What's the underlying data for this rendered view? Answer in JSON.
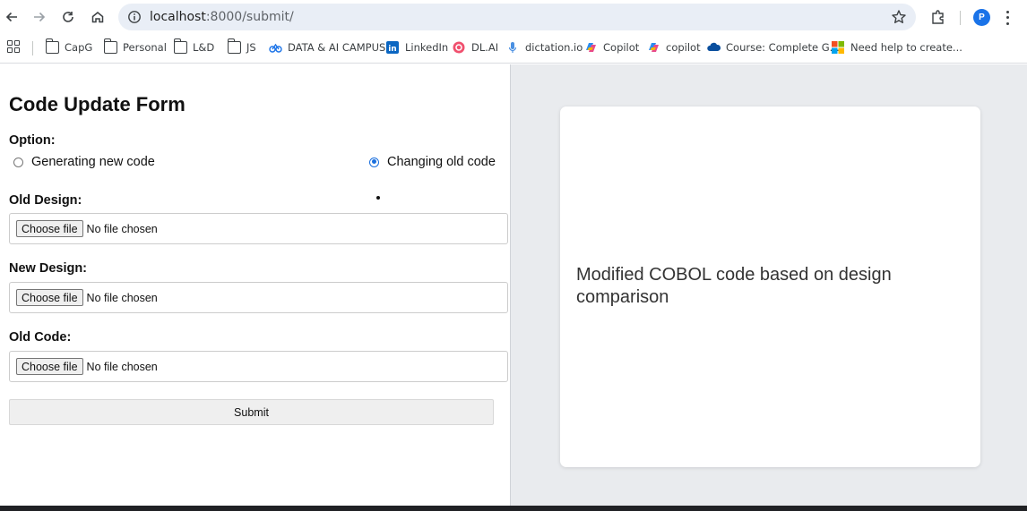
{
  "browser": {
    "url_host": "localhost",
    "url_path": ":8000/submit/",
    "profile_initial": "P",
    "colors": {
      "profile": "#1a73e8",
      "omnibox": "#e9eef6"
    }
  },
  "bookmarks": [
    {
      "label": "CapG",
      "icon": "folder-icon"
    },
    {
      "label": "Personal",
      "icon": "folder-icon"
    },
    {
      "label": "L&D",
      "icon": "folder-icon"
    },
    {
      "label": "JS",
      "icon": "folder-icon"
    },
    {
      "label": "DATA & AI CAMPUS",
      "icon": "campus-icon"
    },
    {
      "label": "LinkedIn",
      "icon": "linkedin-icon"
    },
    {
      "label": "DL.AI",
      "icon": "dlai-icon"
    },
    {
      "label": "dictation.io",
      "icon": "mic-icon"
    },
    {
      "label": "Copilot",
      "icon": "copilot-icon"
    },
    {
      "label": "copilot",
      "icon": "copilot-icon"
    },
    {
      "label": "Course: Complete G...",
      "icon": "cloud-icon"
    },
    {
      "label": "Need help to create...",
      "icon": "microsoft-icon"
    }
  ],
  "form": {
    "title": "Code Update Form",
    "option_label": "Option:",
    "options": [
      {
        "label": "Generating new code",
        "checked": false
      },
      {
        "label": "Changing old code",
        "checked": true
      }
    ],
    "old_design_label": "Old Design:",
    "new_design_label": "New Design:",
    "old_code_label": "Old Code:",
    "choose_file": "Choose file",
    "no_file": "No file chosen",
    "submit": "Submit"
  },
  "output": {
    "text": "Modified COBOL code based on design comparison"
  }
}
